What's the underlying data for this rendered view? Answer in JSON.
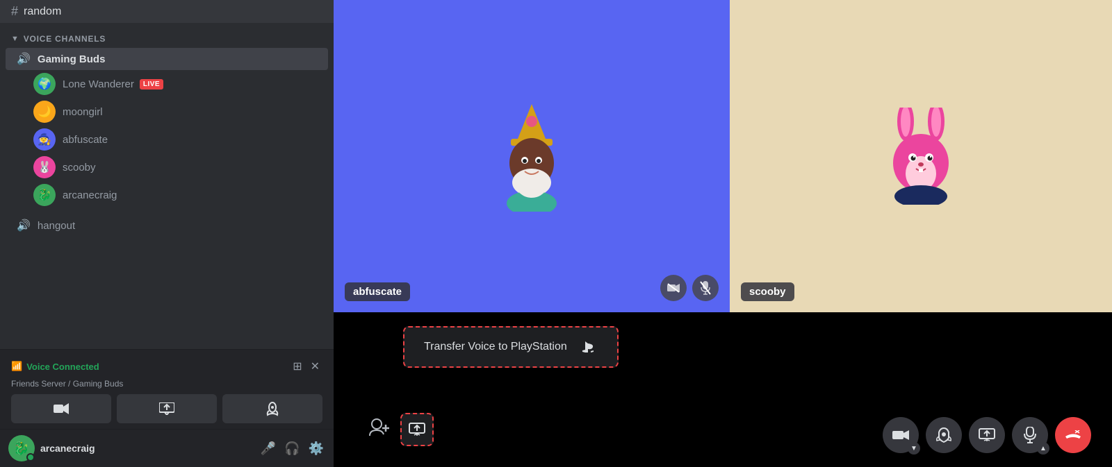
{
  "sidebar": {
    "text_channel": "random",
    "voice_channels_header": "VOICE CHANNELS",
    "voice_channels": [
      {
        "name": "Gaming Buds",
        "active": true,
        "members": [
          {
            "name": "Lone Wanderer",
            "live": true,
            "avatar_bg": "#3ba55c",
            "avatar_emoji": "🌍"
          },
          {
            "name": "moongirl",
            "live": false,
            "avatar_bg": "#faa61a",
            "avatar_emoji": "🌙"
          },
          {
            "name": "abfuscate",
            "live": false,
            "avatar_bg": "#5865f2",
            "avatar_emoji": "🧙"
          },
          {
            "name": "scooby",
            "live": false,
            "avatar_bg": "#eb459e",
            "avatar_emoji": "🐰"
          },
          {
            "name": "arcanecraig",
            "live": false,
            "avatar_bg": "#3ba55c",
            "avatar_emoji": "🐉"
          }
        ]
      },
      {
        "name": "hangout",
        "active": false,
        "members": []
      }
    ],
    "voice_connected": {
      "status": "Voice Connected",
      "server": "Friends Server / Gaming Buds"
    },
    "user": {
      "name": "arcanecraig",
      "avatar_emoji": "🐉",
      "avatar_bg": "#3ba55c"
    },
    "labels": {
      "video": "📷",
      "screen": "📤",
      "activity": "🚀",
      "live_badge": "LIVE"
    }
  },
  "video_tiles": {
    "abfuscate": {
      "name": "abfuscate",
      "bg_color": "#5865f2"
    },
    "scooby": {
      "name": "scooby",
      "bg_color": "#e8d9b5"
    }
  },
  "bottom_bar": {
    "transfer_voice_label": "Transfer Voice to PlayStation",
    "transfer_voice_icon": "🎮"
  },
  "controls": {
    "camera": "📷",
    "activity": "🚀",
    "screen": "📤",
    "mic": "🎤",
    "end_call": "📞"
  }
}
